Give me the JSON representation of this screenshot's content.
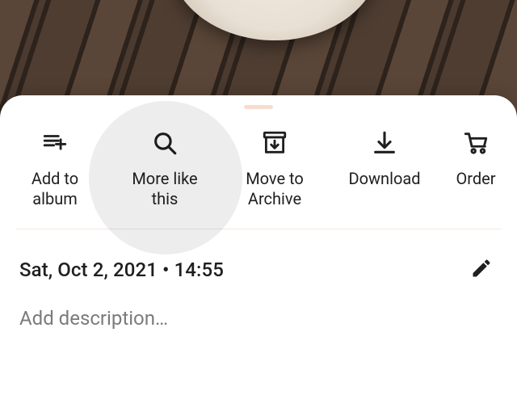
{
  "actions": [
    {
      "label": "Add to\nalbum",
      "icon": "playlist-add-icon"
    },
    {
      "label": "More like\nthis",
      "icon": "search-icon"
    },
    {
      "label": "Move to\nArchive",
      "icon": "archive-icon"
    },
    {
      "label": "Download",
      "icon": "download-icon"
    },
    {
      "label": "Order",
      "icon": "cart-icon"
    }
  ],
  "highlighted_action_index": 1,
  "meta": {
    "datetime": "Sat, Oct 2, 2021 • 14:55"
  },
  "description": {
    "placeholder": "Add description…"
  }
}
